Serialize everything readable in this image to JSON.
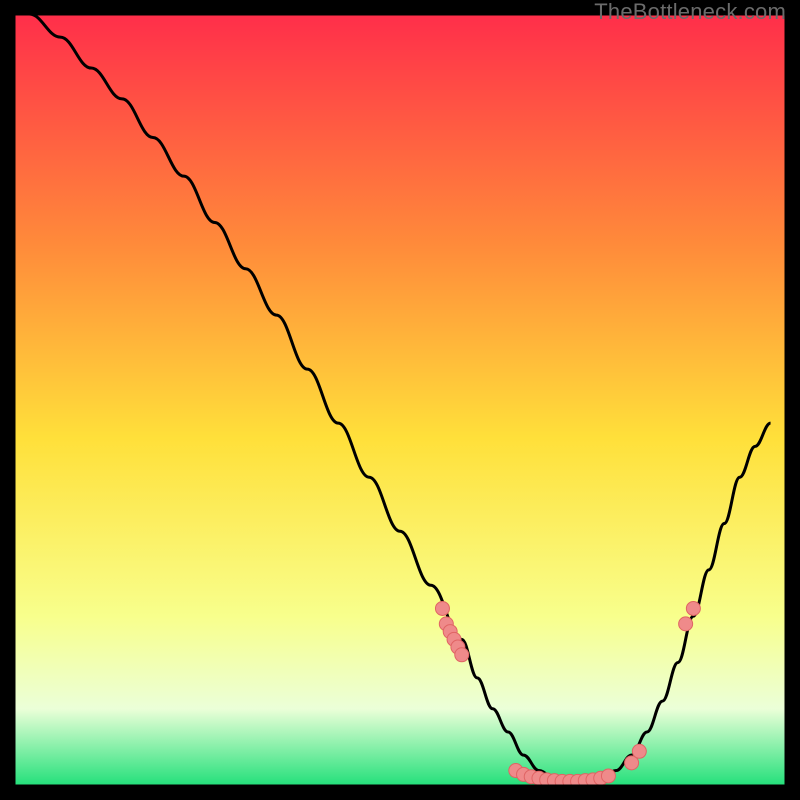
{
  "watermark": "TheBottleneck.com",
  "colors": {
    "gradient_top": "#ff2e4a",
    "gradient_mid_upper": "#ff8b3a",
    "gradient_mid": "#ffe03a",
    "gradient_lower": "#f8ff8c",
    "gradient_lowest": "#ebffd8",
    "gradient_bottom": "#22e07a",
    "curve": "#000000",
    "marker_fill": "#ef8a8a",
    "marker_stroke": "#e06464",
    "frame": "#000000"
  },
  "chart_data": {
    "type": "line",
    "title": "",
    "xlabel": "",
    "ylabel": "",
    "xlim": [
      0,
      100
    ],
    "ylim": [
      0,
      100
    ],
    "curve": {
      "x": [
        2,
        6,
        10,
        14,
        18,
        22,
        26,
        30,
        34,
        38,
        42,
        46,
        50,
        54,
        58,
        60,
        62,
        64,
        66,
        68,
        70,
        72,
        74,
        76,
        78,
        80,
        82,
        84,
        86,
        88,
        90,
        92,
        94,
        96,
        98
      ],
      "y": [
        100,
        97,
        93,
        89,
        84,
        79,
        73,
        67,
        61,
        54,
        47,
        40,
        33,
        26,
        19,
        14,
        10,
        7,
        4,
        2,
        1,
        0.5,
        0.5,
        1,
        2,
        4,
        7,
        11,
        16,
        22,
        28,
        34,
        40,
        44,
        47
      ]
    },
    "markers": [
      {
        "x": 55.5,
        "y": 23
      },
      {
        "x": 56.0,
        "y": 21
      },
      {
        "x": 56.5,
        "y": 20
      },
      {
        "x": 57.0,
        "y": 19
      },
      {
        "x": 57.5,
        "y": 18
      },
      {
        "x": 58.0,
        "y": 17
      },
      {
        "x": 65.0,
        "y": 2
      },
      {
        "x": 66.0,
        "y": 1.5
      },
      {
        "x": 67.0,
        "y": 1.2
      },
      {
        "x": 68.0,
        "y": 1.0
      },
      {
        "x": 69.0,
        "y": 0.8
      },
      {
        "x": 70.0,
        "y": 0.7
      },
      {
        "x": 71.0,
        "y": 0.6
      },
      {
        "x": 72.0,
        "y": 0.6
      },
      {
        "x": 73.0,
        "y": 0.6
      },
      {
        "x": 74.0,
        "y": 0.7
      },
      {
        "x": 75.0,
        "y": 0.8
      },
      {
        "x": 76.0,
        "y": 1.0
      },
      {
        "x": 77.0,
        "y": 1.3
      },
      {
        "x": 80.0,
        "y": 3.0
      },
      {
        "x": 81.0,
        "y": 4.5
      },
      {
        "x": 87.0,
        "y": 21
      },
      {
        "x": 88.0,
        "y": 23
      }
    ]
  }
}
